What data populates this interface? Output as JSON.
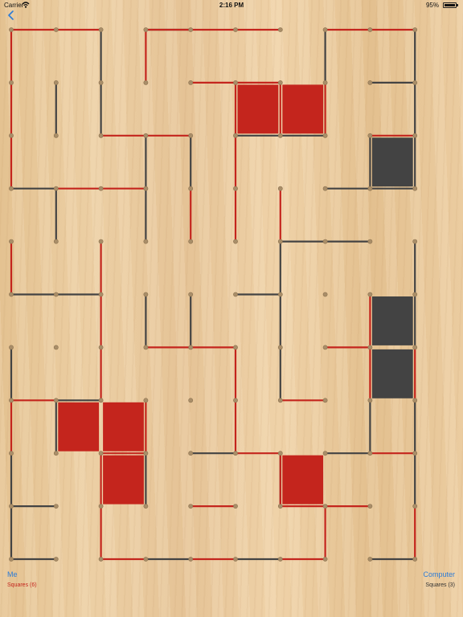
{
  "status_bar": {
    "carrier": "Carrier",
    "time": "2:16 PM",
    "battery": "95%"
  },
  "icons": {
    "back": "back-chevron-icon",
    "wifi": "wifi-icon",
    "battery": "battery-icon"
  },
  "colors": {
    "me": "#c4251d",
    "computer": "#434343",
    "dot": "#a98e69",
    "link": "#2c7bd6"
  },
  "players": {
    "me": {
      "name": "Me",
      "score_text": "Squares (6)"
    },
    "computer": {
      "name": "Computer",
      "score_text": "Squares (3)"
    }
  },
  "board": {
    "dots_rows": 11,
    "dots_cols": 10,
    "lines_by_me": [
      "H 0 0",
      "H 0 1",
      "H 0 3",
      "H 0 4",
      "H 0 5",
      "H 0 7",
      "H 0 8",
      "H 1 4",
      "H 1 5",
      "H 2 2",
      "H 2 3",
      "H 2 8",
      "H 3 1",
      "H 3 2",
      "H 6 3",
      "H 6 4",
      "H 6 7",
      "H 7 0",
      "H 7 6",
      "H 8 2",
      "H 8 5",
      "H 8 8",
      "H 9 4",
      "H 9 6",
      "H 9 7",
      "H 10 2",
      "H 10 4",
      "H 10 6",
      "V 0 0",
      "V 1 0",
      "V 2 0",
      "V 4 0",
      "V 7 0",
      "V 0 3",
      "V 1 5",
      "V 1 6",
      "V 1 7",
      "V 2 5",
      "V 3 4",
      "V 3 5",
      "V 3 6",
      "V 4 2",
      "V 5 2",
      "V 6 2",
      "V 7 3",
      "V 8 2",
      "V 9 2",
      "V 9 7",
      "V 9 9",
      "V 5 8",
      "V 6 8",
      "V 6 5",
      "V 7 5",
      "V 8 6",
      "V 6 9"
    ],
    "lines_by_computer": [
      "H 0 3",
      "H 1 8",
      "H 3 0",
      "H 3 7",
      "H 4 6",
      "H 4 7",
      "H 5 0",
      "H 5 1",
      "H 5 5",
      "H 7 1",
      "H 8 4",
      "H 8 7",
      "H 9 0",
      "H 10 0",
      "H 10 3",
      "H 10 5",
      "H 10 8",
      "H 2 5",
      "H 2 6",
      "H 3 8",
      "V 0 2",
      "V 1 2",
      "V 1 1",
      "V 0 7",
      "V 1 9",
      "V 0 9",
      "V 2 4",
      "V 2 9",
      "V 3 1",
      "V 3 3",
      "V 4 6",
      "V 4 9",
      "V 5 4",
      "V 5 6",
      "V 5 3",
      "V 6 0",
      "V 7 1",
      "V 7 8",
      "V 8 0",
      "V 8 3",
      "V 9 0",
      "V 7 9",
      "V 8 9",
      "V 8 6",
      "V 6 6",
      "V 5 9",
      "V 2 8",
      "V 2 3"
    ],
    "squares": [
      {
        "row": 1,
        "col": 5,
        "owner": "me"
      },
      {
        "row": 1,
        "col": 6,
        "owner": "me"
      },
      {
        "row": 2,
        "col": 8,
        "owner": "computer"
      },
      {
        "row": 5,
        "col": 8,
        "owner": "computer"
      },
      {
        "row": 6,
        "col": 8,
        "owner": "computer"
      },
      {
        "row": 7,
        "col": 1,
        "owner": "me"
      },
      {
        "row": 7,
        "col": 2,
        "owner": "me"
      },
      {
        "row": 8,
        "col": 2,
        "owner": "me"
      },
      {
        "row": 8,
        "col": 6,
        "owner": "me"
      }
    ]
  }
}
